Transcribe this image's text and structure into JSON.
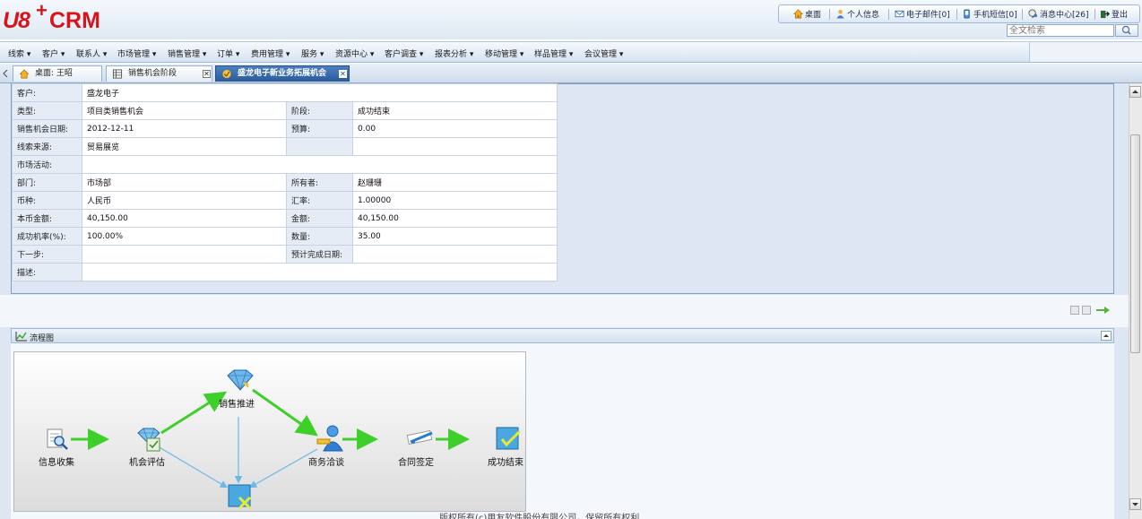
{
  "app": {
    "logo_u8": "U8",
    "logo_plus": "+",
    "logo_crm": "CRM",
    "brand_color": "#d8141b"
  },
  "toplinks": [
    {
      "label": "桌面",
      "icon": "home-icon"
    },
    {
      "label": "个人信息",
      "icon": "user-icon"
    },
    {
      "label": "电子邮件[0]",
      "icon": "mail-icon"
    },
    {
      "label": "手机短信[0]",
      "icon": "phone-icon"
    },
    {
      "label": "消息中心[26]",
      "icon": "message-icon"
    },
    {
      "label": "登出",
      "icon": "logout-icon"
    }
  ],
  "search": {
    "placeholder": "全文检索",
    "icon": "search-icon"
  },
  "menu": [
    "线索 ▾",
    "客户 ▾",
    "联系人 ▾",
    "市场管理 ▾",
    "销售管理 ▾",
    "订单 ▾",
    "费用管理 ▾",
    "服务 ▾",
    "资源中心 ▾",
    "客户调查 ▾",
    "报表分析 ▾",
    "移动管理 ▾",
    "样品管理 ▾",
    "会议管理 ▾"
  ],
  "tabs": [
    {
      "label": "桌面: 王昭",
      "icon": "home-icon",
      "active": false
    },
    {
      "label": "销售机会阶段",
      "icon": "grid-icon",
      "active": false,
      "close": "✕"
    },
    {
      "label": "盛龙电子新业务拓展机会",
      "icon": "opportunity-icon",
      "active": true,
      "close": "✕"
    }
  ],
  "detail": {
    "rows": [
      {
        "l1": "客户:",
        "v1": "盛龙电子",
        "l2": "",
        "v2": "",
        "span": true
      },
      {
        "l1": "类型:",
        "v1": "项目类销售机会",
        "l2": "阶段:",
        "v2": "成功结束"
      },
      {
        "l1": "销售机会日期:",
        "v1": "2012-12-11",
        "l2": "预算:",
        "v2": "0.00"
      },
      {
        "l1": "线索来源:",
        "v1": "贸易展览",
        "l2": "",
        "v2": ""
      },
      {
        "l1": "市场活动:",
        "v1": "",
        "l2": "",
        "v2": "",
        "span": true
      },
      {
        "l1": "部门:",
        "v1": "市场部",
        "l2": "所有者:",
        "v2": "赵珊珊"
      },
      {
        "l1": "币种:",
        "v1": "人民币",
        "l2": "汇率:",
        "v2": "1.00000"
      },
      {
        "l1": "本币金额:",
        "v1": "40,150.00",
        "l2": "金额:",
        "v2": "40,150.00"
      },
      {
        "l1": "成功机率(%):",
        "v1": "100.00%",
        "l2": "数量:",
        "v2": "35.00"
      },
      {
        "l1": "下一步:",
        "v1": "",
        "l2": "预计完成日期:",
        "v2": ""
      },
      {
        "l1": "描述:",
        "v1": "",
        "l2": "",
        "v2": "",
        "span": true
      }
    ]
  },
  "flow": {
    "title": "流程图",
    "nodes": {
      "info": "信息收集",
      "evaluate": "机会评估",
      "promote": "销售推进",
      "negotiate": "商务洽谈",
      "contract": "合同签定",
      "success": "成功结束"
    },
    "colors": {
      "main_path": "#3fcf2a",
      "alt_path": "#6ab8e8"
    }
  },
  "footer": {
    "text": "版权所有(c)用友软件股份有限公司，保留所有权利"
  }
}
